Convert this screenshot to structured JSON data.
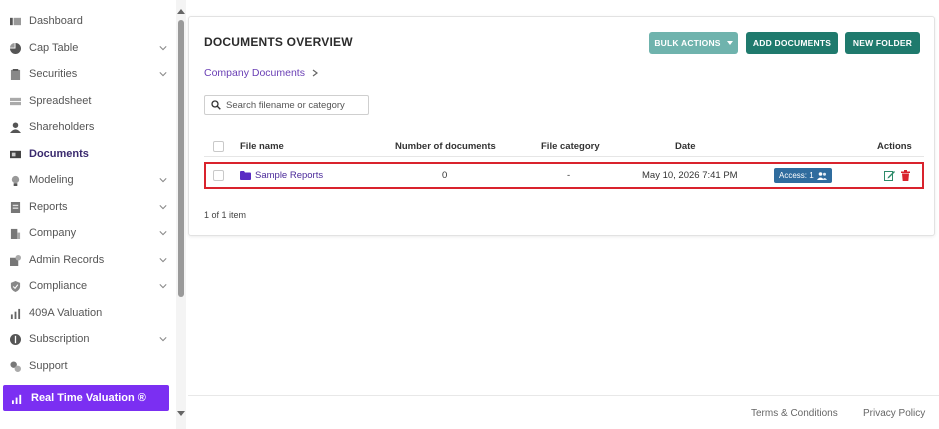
{
  "sidebar": {
    "items": [
      {
        "label": "Dashboard",
        "icon": "dashboard-icon",
        "has_children": false,
        "active": false
      },
      {
        "label": "Cap Table",
        "icon": "pie-chart-icon",
        "has_children": true,
        "active": false
      },
      {
        "label": "Securities",
        "icon": "clipboard-icon",
        "has_children": true,
        "active": false
      },
      {
        "label": "Spreadsheet",
        "icon": "spreadsheet-icon",
        "has_children": false,
        "active": false
      },
      {
        "label": "Shareholders",
        "icon": "user-icon",
        "has_children": false,
        "active": false
      },
      {
        "label": "Documents",
        "icon": "documents-icon",
        "has_children": false,
        "active": true
      },
      {
        "label": "Modeling",
        "icon": "lightbulb-icon",
        "has_children": true,
        "active": false
      },
      {
        "label": "Reports",
        "icon": "report-icon",
        "has_children": true,
        "active": false
      },
      {
        "label": "Company",
        "icon": "building-icon",
        "has_children": true,
        "active": false
      },
      {
        "label": "Admin Records",
        "icon": "admin-icon",
        "has_children": true,
        "active": false
      },
      {
        "label": "Compliance",
        "icon": "shield-check-icon",
        "has_children": true,
        "active": false
      },
      {
        "label": "409A Valuation",
        "icon": "bar-chart-icon",
        "has_children": false,
        "active": false
      },
      {
        "label": "Subscription",
        "icon": "dollar-icon",
        "has_children": true,
        "active": false
      },
      {
        "label": "Support",
        "icon": "support-icon",
        "has_children": false,
        "active": false
      }
    ],
    "cta": {
      "label": "Real Time Valuation ®",
      "icon": "trend-chart-icon"
    }
  },
  "documents": {
    "title": "DOCUMENTS OVERVIEW",
    "buttons": {
      "bulk": "BULK ACTIONS",
      "add": "ADD DOCUMENTS",
      "new_folder": "NEW FOLDER"
    },
    "breadcrumb": "Company Documents",
    "search": {
      "placeholder": "Search filename or category",
      "value": ""
    },
    "columns": {
      "file_name": "File name",
      "count": "Number of documents",
      "category": "File category",
      "date": "Date",
      "actions": "Actions"
    },
    "rows": [
      {
        "name": "Sample Reports",
        "count": "0",
        "category": "-",
        "date": "May 10, 2026 7:41 PM",
        "access": "Access: 1"
      }
    ],
    "paging": "1 of 1 item"
  },
  "footer": {
    "terms": "Terms & Conditions",
    "privacy": "Privacy Policy"
  },
  "colors": {
    "brand_purple": "#7b2ff2",
    "teal": "#1f7a6d",
    "teal_light": "#6fb3ad",
    "highlight_red": "#d9232d",
    "access_blue": "#2f6c9e"
  }
}
